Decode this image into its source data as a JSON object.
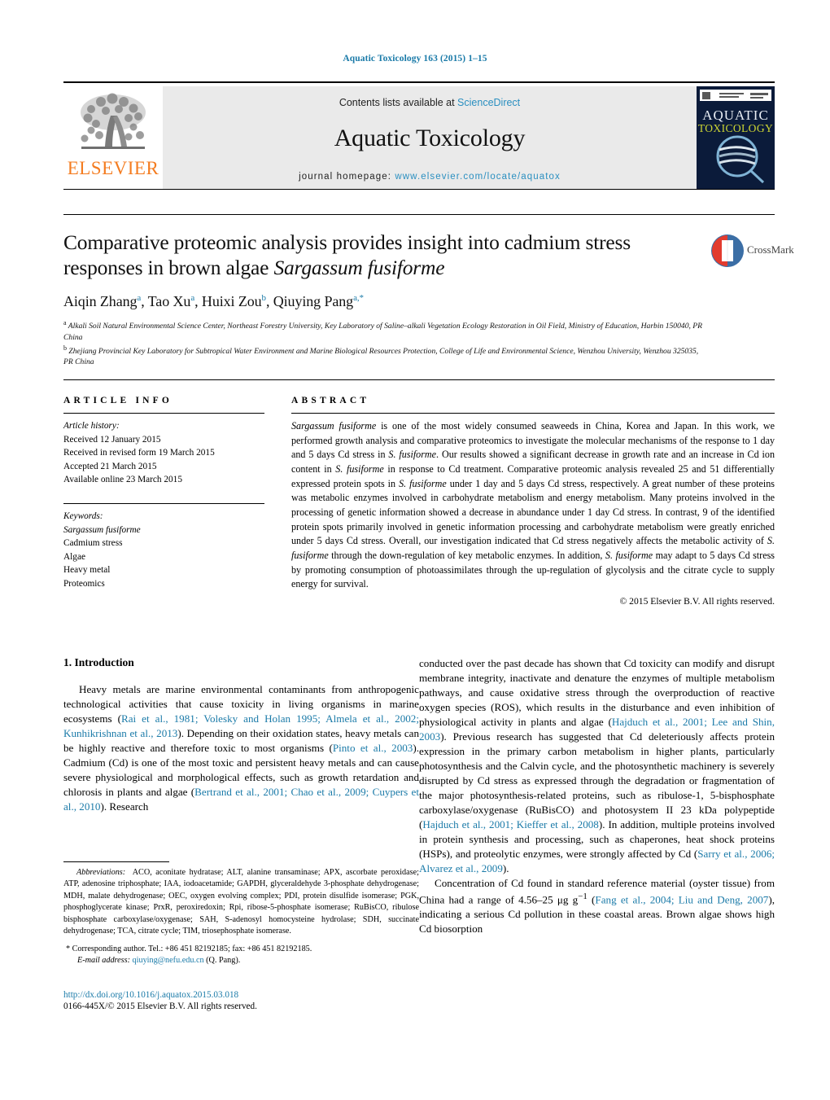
{
  "running_head": "Aquatic Toxicology 163 (2015) 1–15",
  "masthead": {
    "publisher_name": "ELSEVIER",
    "contents_prefix": "Contents lists available at ",
    "contents_link": "ScienceDirect",
    "journal_title": "Aquatic Toxicology",
    "homepage_prefix": "journal homepage: ",
    "homepage_url": "www.elsevier.com/locate/aquatox",
    "cover": {
      "line1": "AQUATIC",
      "line2": "TOXICOLOGY"
    }
  },
  "article": {
    "title_part1": "Comparative proteomic analysis provides insight into cadmium stress responses in brown algae ",
    "title_species": "Sargassum fusiforme",
    "authors": [
      {
        "name": "Aiqin Zhang",
        "sup": "a",
        "sep": ", "
      },
      {
        "name": "Tao Xu",
        "sup": "a",
        "sep": ", "
      },
      {
        "name": "Huixi Zou",
        "sup": "b",
        "sep": ", "
      },
      {
        "name": "Qiuying Pang",
        "sup": "a,*",
        "sep": ""
      }
    ],
    "affiliations": [
      {
        "mark": "a",
        "text": "Alkali Soil Natural Environmental Science Center, Northeast Forestry University, Key Laboratory of Saline–alkali Vegetation Ecology Restoration in Oil Field, Ministry of Education, Harbin 150040, PR China"
      },
      {
        "mark": "b",
        "text": "Zhejiang Provincial Key Laboratory for Subtropical Water Environment and Marine Biological Resources Protection, College of Life and Environmental Science, Wenzhou University, Wenzhou 325035, PR China"
      }
    ],
    "crossmark_label": "CrossMark"
  },
  "article_info": {
    "heading": "ARTICLE INFO",
    "history_label": "Article history:",
    "history": [
      "Received 12 January 2015",
      "Received in revised form 19 March 2015",
      "Accepted 21 March 2015",
      "Available online 23 March 2015"
    ],
    "keywords_label": "Keywords:",
    "keywords": [
      "Sargassum fusiforme",
      "Cadmium stress",
      "Algae",
      "Heavy metal",
      "Proteomics"
    ]
  },
  "abstract": {
    "heading": "ABSTRACT",
    "text_segments": [
      {
        "italic": true,
        "t": "Sargassum fusiforme"
      },
      {
        "italic": false,
        "t": " is one of the most widely consumed seaweeds in China, Korea and Japan. In this work, we performed growth analysis and comparative proteomics to investigate the molecular mechanisms of the response to 1 day and 5 days Cd stress in "
      },
      {
        "italic": true,
        "t": "S. fusiforme"
      },
      {
        "italic": false,
        "t": ". Our results showed a significant decrease in growth rate and an increase in Cd ion content in "
      },
      {
        "italic": true,
        "t": "S. fusiforme"
      },
      {
        "italic": false,
        "t": " in response to Cd treatment. Comparative proteomic analysis revealed 25 and 51 differentially expressed protein spots in "
      },
      {
        "italic": true,
        "t": "S. fusiforme"
      },
      {
        "italic": false,
        "t": " under 1 day and 5 days Cd stress, respectively. A great number of these proteins was metabolic enzymes involved in carbohydrate metabolism and energy metabolism. Many proteins involved in the processing of genetic information showed a decrease in abundance under 1 day Cd stress. In contrast, 9 of the identified protein spots primarily involved in genetic information processing and carbohydrate metabolism were greatly enriched under 5 days Cd stress. Overall, our investigation indicated that Cd stress negatively affects the metabolic activity of "
      },
      {
        "italic": true,
        "t": "S. fusiforme"
      },
      {
        "italic": false,
        "t": " through the down-regulation of key metabolic enzymes. In addition, "
      },
      {
        "italic": true,
        "t": "S. fusiforme"
      },
      {
        "italic": false,
        "t": " may adapt to 5 days Cd stress by promoting consumption of photoassimilates through the up-regulation of glycolysis and the citrate cycle to supply energy for survival."
      }
    ],
    "copyright": "© 2015 Elsevier B.V. All rights reserved."
  },
  "introduction": {
    "heading": "1.  Introduction",
    "left_paragraph_segments": [
      {
        "ref": false,
        "t": "Heavy metals are marine environmental contaminants from anthropogenic technological activities that cause toxicity in living organisms in marine ecosystems ("
      },
      {
        "ref": true,
        "t": "Rai et al., 1981; Volesky and Holan 1995; Almela et al., 2002; Kunhikrishnan et al., 2013"
      },
      {
        "ref": false,
        "t": "). Depending on their oxidation states, heavy metals can be highly reactive and therefore toxic to most organisms ("
      },
      {
        "ref": true,
        "t": "Pinto et al., 2003"
      },
      {
        "ref": false,
        "t": "). Cadmium (Cd) is one of the most toxic and persistent heavy metals and can cause severe physiological and morphological effects, such as growth retardation and chlorosis in plants and algae ("
      },
      {
        "ref": true,
        "t": "Bertrand et al., 2001; Chao et al., 2009; Cuypers et al., 2010"
      },
      {
        "ref": false,
        "t": "). Research"
      }
    ],
    "right_paragraph1_segments": [
      {
        "ref": false,
        "t": "conducted over the past decade has shown that Cd toxicity can modify and disrupt membrane integrity, inactivate and denature the enzymes of multiple metabolism pathways, and cause oxidative stress through the overproduction of reactive oxygen species (ROS), which results in the disturbance and even inhibition of physiological activity in plants and algae ("
      },
      {
        "ref": true,
        "t": "Hajduch et al., 2001; Lee and Shin, 2003"
      },
      {
        "ref": false,
        "t": "). Previous research has suggested that Cd deleteriously affects protein expression in the primary carbon metabolism in higher plants, particularly photosynthesis and the Calvin cycle, and the photosynthetic machinery is severely disrupted by Cd stress as expressed through the degradation or fragmentation of the major photosynthesis-related proteins, such as ribulose-1, 5-bisphosphate carboxylase/oxygenase (RuBisCO) and photosystem II 23 kDa polypeptide ("
      },
      {
        "ref": true,
        "t": "Hajduch et al., 2001; Kieffer et al., 2008"
      },
      {
        "ref": false,
        "t": "). In addition, multiple proteins involved in protein synthesis and processing, such as chaperones, heat shock proteins (HSPs), and proteolytic enzymes, were strongly affected by Cd ("
      },
      {
        "ref": true,
        "t": "Sarry et al., 2006; Alvarez et al., 2009"
      },
      {
        "ref": false,
        "t": ")."
      }
    ],
    "right_paragraph2_segments": [
      {
        "ref": false,
        "t": "Concentration of Cd found in standard reference material (oyster tissue) from China had a range of 4.56–25 μg g"
      },
      {
        "sup": true,
        "t": "−1"
      },
      {
        "ref": false,
        "t": " ("
      },
      {
        "ref": true,
        "t": "Fang et al., 2004; Liu and Deng, 2007"
      },
      {
        "ref": false,
        "t": "), indicating a serious Cd pollution in these coastal areas. Brown algae shows high Cd biosorption"
      }
    ]
  },
  "footnotes": {
    "abbrev_label": "Abbreviations:",
    "abbrev_text": "ACO, aconitate hydratase; ALT, alanine transaminase; APX, ascorbate peroxidase; ATP, adenosine triphosphate; IAA, iodoacetamide; GAPDH, glyceraldehyde 3-phosphate dehydrogenase; MDH, malate dehydrogenase; OEC, oxygen evolving complex; PDI, protein disulfide isomerase; PGK, phosphoglycerate kinase; PrxR, peroxiredoxin; Rpi, ribose-5-phosphate isomerase; RuBisCO, ribulose bisphosphate carboxylase/oxygenase; SAH, S-adenosyl homocysteine hydrolase; SDH, succinate dehydrogenase; TCA, citrate cycle; TIM, triosephosphate isomerase.",
    "corresponding_mark": "*",
    "corresponding_text": "Corresponding author. Tel.: +86 451 82192185; fax: +86 451 82192185.",
    "email_label": "E-mail address:",
    "email_address": "qiuying@nefu.edu.cn",
    "email_suffix": "(Q. Pang)."
  },
  "footer": {
    "doi_url": "http://dx.doi.org/10.1016/j.aquatox.2015.03.018",
    "issn_line": "0166-445X/© 2015 Elsevier B.V. All rights reserved."
  },
  "colors": {
    "link": "#1a7aa8",
    "elsevier_orange": "#F47C20",
    "band_gray": "#eaeaea",
    "cover_navy": "#0b1b3a"
  }
}
